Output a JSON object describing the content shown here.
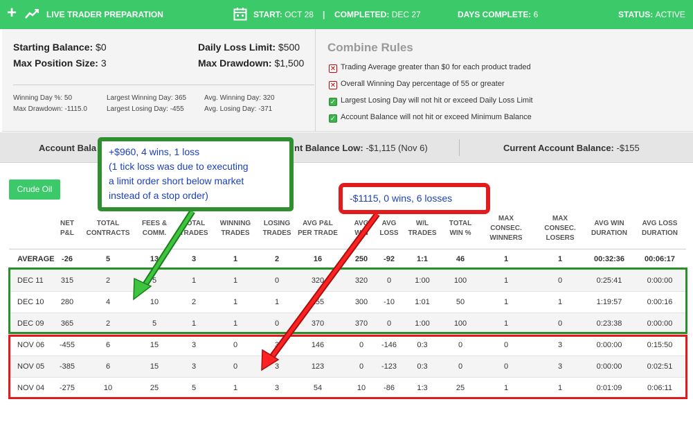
{
  "header": {
    "title": "LIVE TRADER PREPARATION",
    "start_label": "START:",
    "start_value": "OCT 28",
    "separator": "|",
    "completed_label": "COMPLETED:",
    "completed_value": "DEC 27",
    "days_label": "DAYS COMPLETE:",
    "days_value": "6",
    "status_label": "STATUS:",
    "status_value": "ACTIVE"
  },
  "account": {
    "starting_balance_label": "Starting Balance:",
    "starting_balance": "$0",
    "max_position_label": "Max Position Size:",
    "max_position": "3",
    "daily_loss_label": "Daily Loss Limit:",
    "daily_loss": "$500",
    "max_drawdown_label": "Max Drawdown:",
    "max_drawdown": "$1,500"
  },
  "stats": {
    "winning_day_pct": "Winning Day %: 50",
    "max_drawdown": "Max Drawdown: -1115.0",
    "largest_winning_day": "Largest Winning Day: 365",
    "largest_losing_day": "Largest Losing Day: -455",
    "avg_winning_day": "Avg. Winning Day: 320",
    "avg_losing_day": "Avg. Losing Day: -371"
  },
  "rules": {
    "title": "Combine Rules",
    "items": [
      {
        "text": "Trading Average greater than $0 for each product traded",
        "passed": false
      },
      {
        "text": "Overall Winning Day percentage of 55 or greater",
        "passed": false
      },
      {
        "text": "Largest Losing Day will not hit or exceed Daily Loss Limit",
        "passed": true
      },
      {
        "text": "Account Balance will not hit or exceed Minimum Balance",
        "passed": true
      }
    ]
  },
  "balances": {
    "account_balance_label": "Account Bala",
    "balance_low_label": "nt Balance Low:",
    "balance_low_value": "-$1,115 (Nov 6)",
    "current_label": "Current Account Balance:",
    "current_value": "-$155"
  },
  "product_tab": "Crude Oil",
  "table": {
    "headers": [
      "NET\nP&L",
      "TOTAL\nCONTRACTS",
      "FEES &\nCOMM.",
      "TOTAL\nTRADES",
      "WINNING\nTRADES",
      "LOSING\nTRADES",
      "AVG P&L\nPER TRADE",
      "AVG\nWIN",
      "AVG\nLOSS",
      "W/L\nTRADES",
      "TOTAL\nWIN %",
      "MAX\nCONSEC.\nWINNERS",
      "MAX\nCONSEC.\nLOSERS",
      "AVG WIN\nDURATION",
      "AVG LOSS\nDURATION"
    ],
    "average": [
      "AVERAGE",
      "-26",
      "5",
      "13",
      "3",
      "1",
      "2",
      "16",
      "250",
      "-92",
      "1:1",
      "46",
      "1",
      "1",
      "00:32:36",
      "00:06:17"
    ],
    "rows": [
      [
        "DEC 11",
        "315",
        "2",
        "5",
        "1",
        "1",
        "0",
        "320",
        "320",
        "0",
        "1:00",
        "100",
        "1",
        "0",
        "0:25:41",
        "0:00:00"
      ],
      [
        "DEC 10",
        "280",
        "4",
        "10",
        "2",
        "1",
        "1",
        "155",
        "300",
        "-10",
        "1:01",
        "50",
        "1",
        "1",
        "1:19:57",
        "0:00:16"
      ],
      [
        "DEC 09",
        "365",
        "2",
        "5",
        "1",
        "1",
        "0",
        "370",
        "370",
        "0",
        "1:00",
        "100",
        "1",
        "0",
        "0:23:38",
        "0:00:00"
      ],
      [
        "NOV 06",
        "-455",
        "6",
        "15",
        "3",
        "0",
        "3",
        "146",
        "0",
        "-146",
        "0:3",
        "0",
        "0",
        "3",
        "0:00:00",
        "0:15:50"
      ],
      [
        "NOV 05",
        "-385",
        "6",
        "15",
        "3",
        "0",
        "3",
        "123",
        "0",
        "-123",
        "0:3",
        "0",
        "0",
        "3",
        "0:00:00",
        "0:02:51"
      ],
      [
        "NOV 04",
        "-275",
        "10",
        "25",
        "5",
        "1",
        "3",
        "54",
        "10",
        "-86",
        "1:3",
        "25",
        "1",
        "1",
        "0:01:09",
        "0:06:11"
      ]
    ]
  },
  "annotations": {
    "green_callout": [
      "+$960, 4 wins, 1 loss",
      "(1 tick loss was due to executing",
      "a limit order short below market",
      "instead of a stop order)"
    ],
    "red_callout": "-$1115, 0 wins, 6 losses"
  },
  "colors": {
    "brand_green": "#3cc96a",
    "annotation_green": "#2a8f2a",
    "annotation_red": "#e01b1b",
    "annotation_text": "#1b3fbf"
  }
}
